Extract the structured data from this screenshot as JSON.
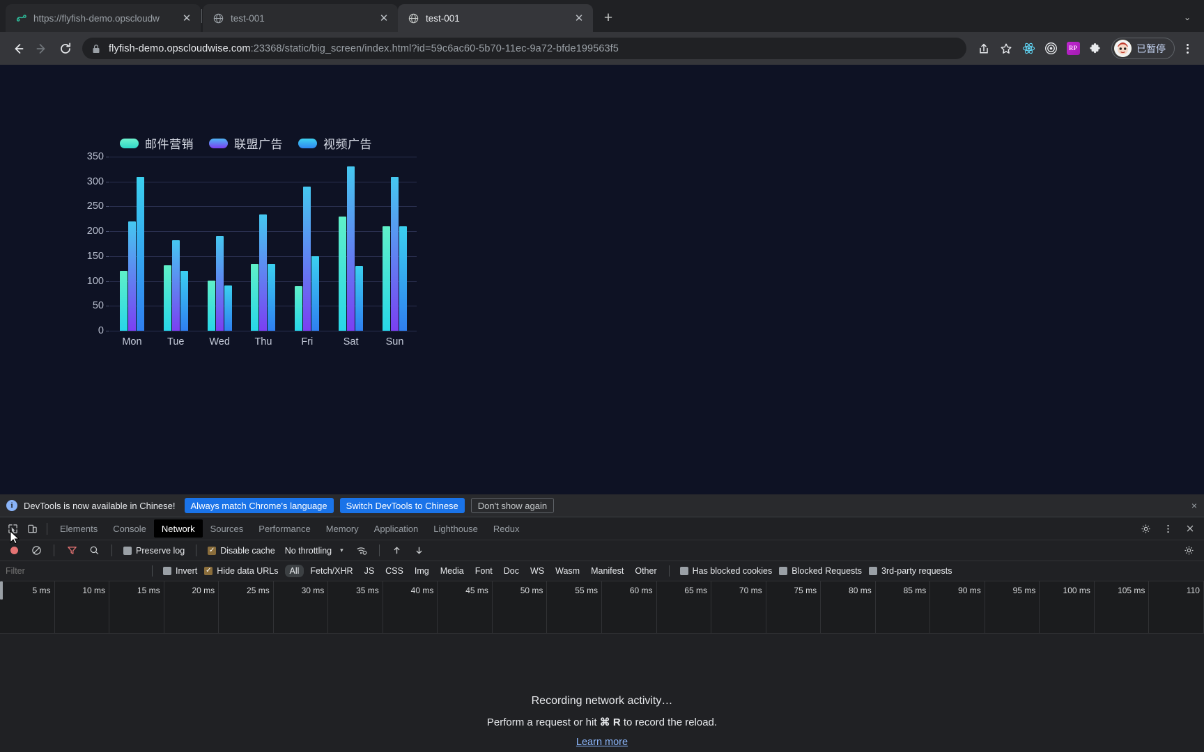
{
  "browser": {
    "tabs": [
      {
        "title": "https://flyfish-demo.opscloudw",
        "favicon": "flyfish-logo-icon",
        "active": false
      },
      {
        "title": "test-001",
        "favicon": "globe-icon",
        "active": false
      },
      {
        "title": "test-001",
        "favicon": "globe-icon",
        "active": true
      }
    ],
    "new_tab_label": "+",
    "tabstrip_menu_label": "⌄",
    "nav": {
      "back": "←",
      "forward": "→",
      "reload": "⟳"
    },
    "omnibox": {
      "lock_icon": "lock-icon",
      "host": "flyfish-demo.opscloudwise.com",
      "rest": ":23368/static/big_screen/index.html?id=59c6ac60-5b70-11ec-9a72-bfde199563f5",
      "full_url": "flyfish-demo.opscloudwise.com:23368/static/big_screen/index.html?id=59c6ac60-5b70-11ec-9a72-bfde199563f5"
    },
    "toolbar_icons": [
      {
        "name": "share-icon",
        "glyph": "⇧"
      },
      {
        "name": "bookmark-star-icon",
        "glyph": "☆"
      },
      {
        "name": "react-devtools-extension-icon",
        "glyph": "⚛"
      },
      {
        "name": "target-extension-icon",
        "glyph": "◎"
      },
      {
        "name": "rp-extension-icon",
        "glyph": "RP"
      },
      {
        "name": "extensions-puzzle-icon",
        "glyph": "❖"
      }
    ],
    "profile": {
      "label": "已暂停",
      "avatar_glyph": "😺"
    }
  },
  "chart_data": {
    "type": "bar",
    "title": "",
    "categories": [
      "Mon",
      "Tue",
      "Wed",
      "Thu",
      "Fri",
      "Sat",
      "Sun"
    ],
    "series": [
      {
        "name": "邮件营销",
        "color": "#5ff0c8",
        "values": [
          120,
          132,
          101,
          134,
          90,
          230,
          210
        ]
      },
      {
        "name": "联盟广告",
        "color": "#7b3ff2",
        "values": [
          220,
          182,
          191,
          234,
          290,
          330,
          310
        ]
      },
      {
        "name": "视频广告",
        "color": "#2f7ff0",
        "values": [
          310,
          121,
          91,
          134,
          150,
          130,
          210
        ]
      }
    ],
    "yticks": [
      0,
      50,
      100,
      150,
      200,
      250,
      300,
      350
    ],
    "ylim": [
      0,
      350
    ],
    "xlabel": "",
    "ylabel": "",
    "grid": true,
    "legend_position": "top"
  },
  "devtools": {
    "banner": {
      "message": "DevTools is now available in Chinese!",
      "primary_btn": "Always match Chrome's language",
      "secondary_btn": "Switch DevTools to Chinese",
      "ghost_btn": "Don't show again",
      "close": "×"
    },
    "tabs": [
      "Elements",
      "Console",
      "Network",
      "Sources",
      "Performance",
      "Memory",
      "Application",
      "Lighthouse",
      "Redux"
    ],
    "active_tab": "Network",
    "toolbar": {
      "record_title": "record",
      "clear_title": "clear",
      "filter_title": "filter",
      "search_title": "search",
      "preserve_log": "Preserve log",
      "preserve_log_checked": false,
      "disable_cache": "Disable cache",
      "disable_cache_checked": true,
      "throttling": "No throttling",
      "caret": "▾"
    },
    "filterbar": {
      "filter_placeholder": "Filter",
      "filter_value": "",
      "invert": "Invert",
      "invert_checked": false,
      "hide_data_urls": "Hide data URLs",
      "hide_data_urls_checked": true,
      "types": [
        "All",
        "Fetch/XHR",
        "JS",
        "CSS",
        "Img",
        "Media",
        "Font",
        "Doc",
        "WS",
        "Wasm",
        "Manifest",
        "Other"
      ],
      "selected_type": "All",
      "has_blocked_cookies": "Has blocked cookies",
      "blocked_requests": "Blocked Requests",
      "third_party_requests": "3rd-party requests"
    },
    "ruler_ticks": [
      "5 ms",
      "10 ms",
      "15 ms",
      "20 ms",
      "25 ms",
      "30 ms",
      "35 ms",
      "40 ms",
      "45 ms",
      "50 ms",
      "55 ms",
      "60 ms",
      "65 ms",
      "70 ms",
      "75 ms",
      "80 ms",
      "85 ms",
      "90 ms",
      "95 ms",
      "100 ms",
      "105 ms",
      "110"
    ],
    "empty_state": {
      "line1": "Recording network activity…",
      "line2_pre": "Perform a request or hit ",
      "line2_kbd": "⌘ R",
      "line2_post": " to record the reload.",
      "link": "Learn more"
    }
  }
}
